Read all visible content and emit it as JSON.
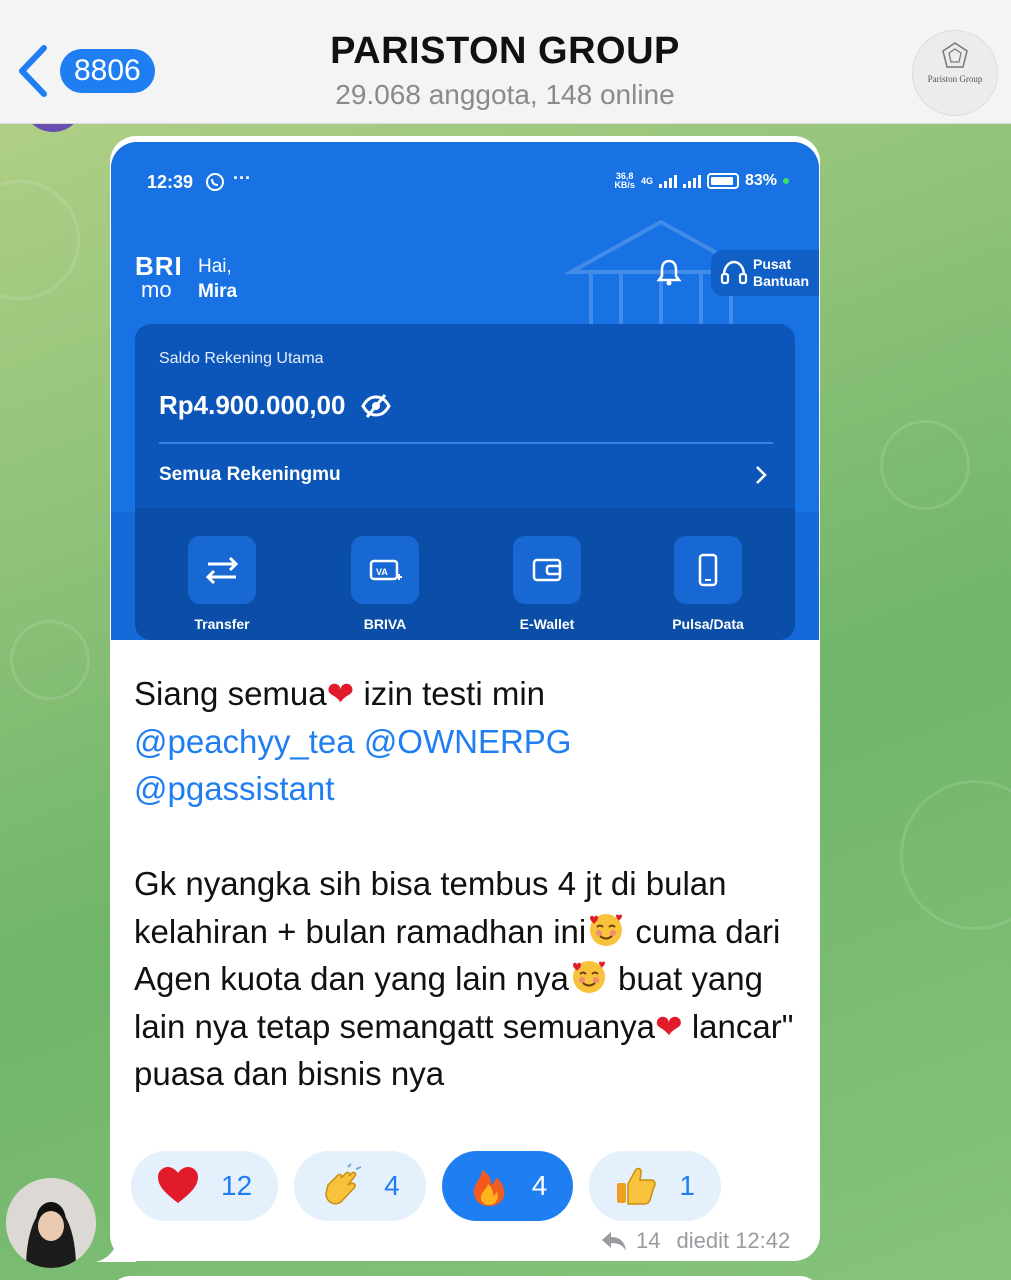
{
  "header": {
    "back_count": "8806",
    "title": "PARISTON GROUP",
    "subtitle": "29.068 anggota, 148 online",
    "group_logo_text": "Pariston Group"
  },
  "screenshot": {
    "status_time": "12:39",
    "status_dots": "···",
    "status_speed": "36,8\nKB/s",
    "status_net": "4G",
    "battery": "83%",
    "brand_line1": "BRI",
    "brand_line2": "mo",
    "greeting": "Hai,",
    "user_name": "Mira",
    "help_line1": "Pusat",
    "help_line2": "Bantuan",
    "balance_label": "Saldo Rekening Utama",
    "balance": "Rp4.900.000,00",
    "accounts_link": "Semua Rekeningmu",
    "menu": [
      {
        "label": "Transfer",
        "icon": "transfer-icon"
      },
      {
        "label": "BRIVA",
        "icon": "briva-icon"
      },
      {
        "label": "E-Wallet",
        "icon": "wallet-icon"
      },
      {
        "label": "Pulsa/Data",
        "icon": "phone-icon"
      }
    ]
  },
  "message": {
    "line1a": "Siang semua",
    "line1b": " izin testi min",
    "mention1": "@peachyy_tea",
    "mention2": "@OWNERPG",
    "mention3": "@pgassistant",
    "body1": "Gk nyangka sih bisa tembus 4 jt di bulan kelahiran + bulan ramadhan ini",
    "body2": " cuma dari Agen kuota dan yang lain nya",
    "body3": " buat yang lain nya tetap semangatt semuanya",
    "body4": " lancar\" puasa dan bisnis nya"
  },
  "reactions": [
    {
      "emoji": "heart",
      "count": "12",
      "active": false
    },
    {
      "emoji": "clap",
      "count": "4",
      "active": false
    },
    {
      "emoji": "fire",
      "count": "4",
      "active": true
    },
    {
      "emoji": "thumbs-up",
      "count": "1",
      "active": false
    }
  ],
  "meta": {
    "replies": "14",
    "edited": "diedit 12:42"
  },
  "colors": {
    "accent": "#1f7ef2",
    "bri_blue": "#1872e4",
    "card_blue": "#0d56b9",
    "heart_red": "#e21b2b"
  }
}
